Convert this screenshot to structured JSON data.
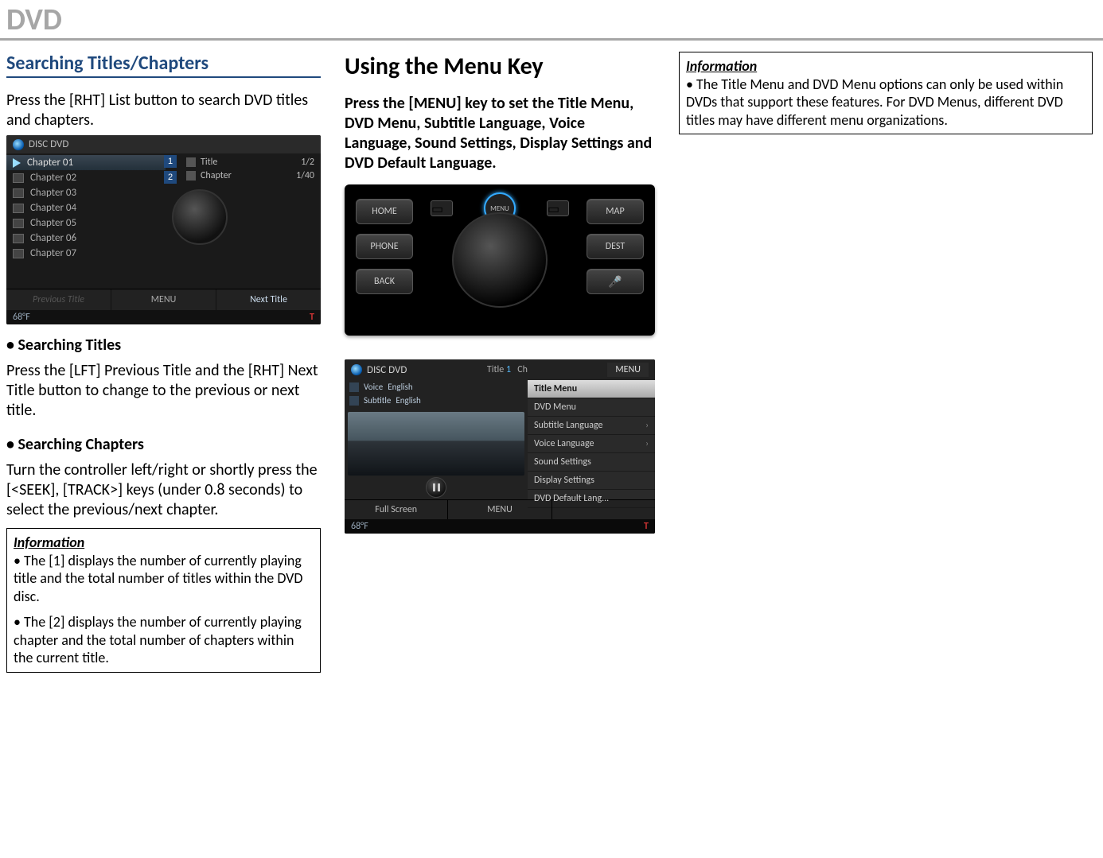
{
  "page_title": "DVD",
  "left": {
    "heading": "Searching Titles/Chapters",
    "intro": "Press the [RHT] List button to search DVD titles and chapters.",
    "sub1_heading": "• Searching Titles",
    "sub1_body": "Press the [LFT] Previous Title and the [RHT] Next Title button to change to the previous or next title.",
    "sub2_heading": "• Searching Chapters",
    "sub2_body": "Turn the controller left/right or shortly press the [<SEEK], [TRACK>] keys (under 0.8 seconds) to select the previous/next chapter.",
    "info_title": "Information",
    "info_bullet1": "• The [1] displays the number of currently playing title and the total number of titles within the DVD disc.",
    "info_bullet2": "• The [2] displays the number of currently playing chapter and the total number of chapters within the current title."
  },
  "mid": {
    "heading": "Using the Menu Key",
    "intro": "Press the [MENU] key to set the Title Menu, DVD Menu, Subtitle Language, Voice Language, Sound Settings, Display Settings and DVD Default Language."
  },
  "right": {
    "info_title": "Information",
    "info_body": "• The Title Menu and DVD Menu options can only be used within DVDs that support these features. For DVD Menus, different DVD titles may have different menu organizations."
  },
  "shot1": {
    "header": "DISC DVD",
    "chapters": [
      "Chapter 01",
      "Chapter 02",
      "Chapter 03",
      "Chapter 04",
      "Chapter 05",
      "Chapter 06",
      "Chapter 07"
    ],
    "selected_index": 0,
    "title_label": "Title",
    "title_value": "1/2",
    "chapter_label": "Chapter",
    "chapter_value": "1/40",
    "marker1": "1",
    "marker2": "2",
    "bottom": {
      "prev": "Previous Title",
      "menu": "MENU",
      "next": "Next Title"
    },
    "temp": "68°F",
    "antenna": "T"
  },
  "shot2": {
    "home": "HOME",
    "map": "MAP",
    "phone": "PHONE",
    "dest": "DEST",
    "back": "BACK",
    "menu": "MENU"
  },
  "shot3": {
    "header": "DISC DVD",
    "title_label": "Title",
    "title_value": "1",
    "ch_label": "Ch",
    "menu_label": "MENU",
    "voice_label": "Voice",
    "voice_value": "English",
    "sub_label": "Subtitle",
    "sub_value": "English",
    "menu_items": [
      {
        "label": "Title Menu",
        "chev": false,
        "sel": true
      },
      {
        "label": "DVD Menu",
        "chev": false,
        "sel": false
      },
      {
        "label": "Subtitle Language",
        "chev": true,
        "sel": false
      },
      {
        "label": "Voice Language",
        "chev": true,
        "sel": false
      },
      {
        "label": "Sound Settings",
        "chev": false,
        "sel": false
      },
      {
        "label": "Display Settings",
        "chev": false,
        "sel": false
      },
      {
        "label": "DVD Default Lang...",
        "chev": false,
        "sel": false
      }
    ],
    "bottom": {
      "full": "Full Screen",
      "menu": "MENU",
      "blank": ""
    },
    "temp": "68°F",
    "antenna": "T"
  }
}
